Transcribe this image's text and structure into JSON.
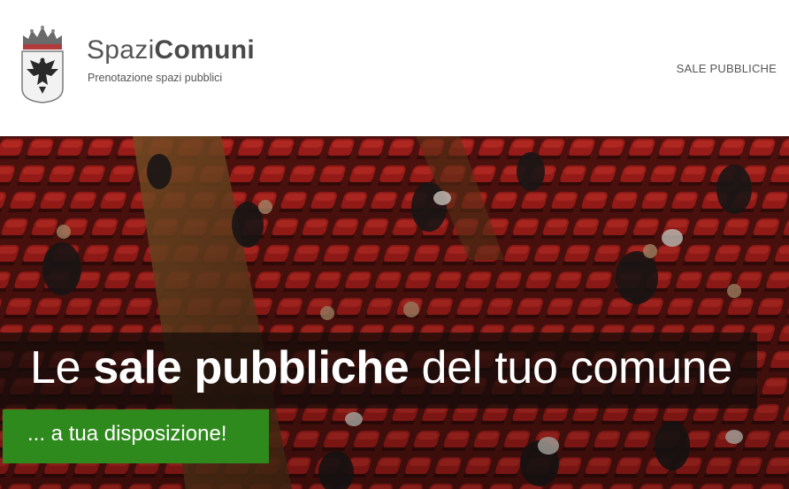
{
  "header": {
    "brand_light": "Spazi",
    "brand_bold": "Comuni",
    "subtitle": "Prenotazione spazi pubblici",
    "crest_icon": "municipal-crest-icon"
  },
  "nav": {
    "items": [
      {
        "label": "SALE PUBBLICHE"
      }
    ]
  },
  "hero": {
    "title_light_1": "Le ",
    "title_bold": "sale pubbliche",
    "title_light_2": " del tuo comune",
    "subtitle": "... a tua disposizione!",
    "image_description_icon": "auditorium-photo",
    "colors": {
      "title_band": "#140c0a",
      "subtitle_band": "#2f8a1d",
      "seat_red": "#b3201c"
    }
  }
}
